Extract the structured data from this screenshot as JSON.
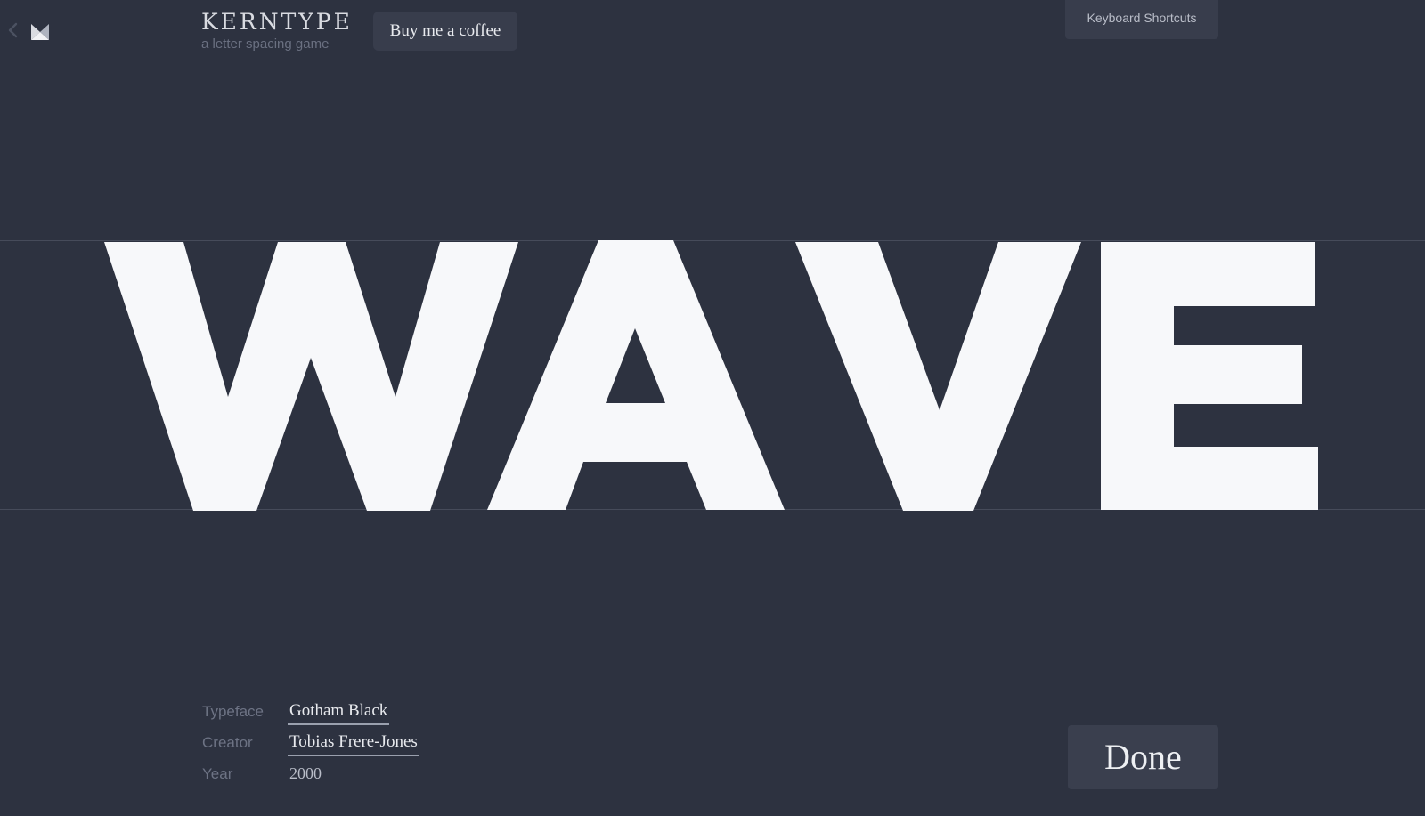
{
  "header": {
    "brand_title": "KERNTYPE",
    "brand_subtitle": "a letter spacing game",
    "coffee_label": "Buy me a coffee",
    "shortcuts_label": "Keyboard Shortcuts"
  },
  "puzzle": {
    "word": "WAVE",
    "letters": [
      "W",
      "A",
      "V",
      "E"
    ],
    "letter_color": "#f7f8fa"
  },
  "info": {
    "typeface_label": "Typeface",
    "typeface_value": "Gotham Black",
    "creator_label": "Creator",
    "creator_value": "Tobias Frere-Jones",
    "year_label": "Year",
    "year_value": "2000"
  },
  "actions": {
    "done_label": "Done"
  },
  "colors": {
    "background": "#2d3240",
    "button_bg": "#383d4c",
    "guide_line": "#464b5a"
  },
  "icons": {
    "back": "chevron-left-icon",
    "logo": "kerntype-logo-icon"
  }
}
